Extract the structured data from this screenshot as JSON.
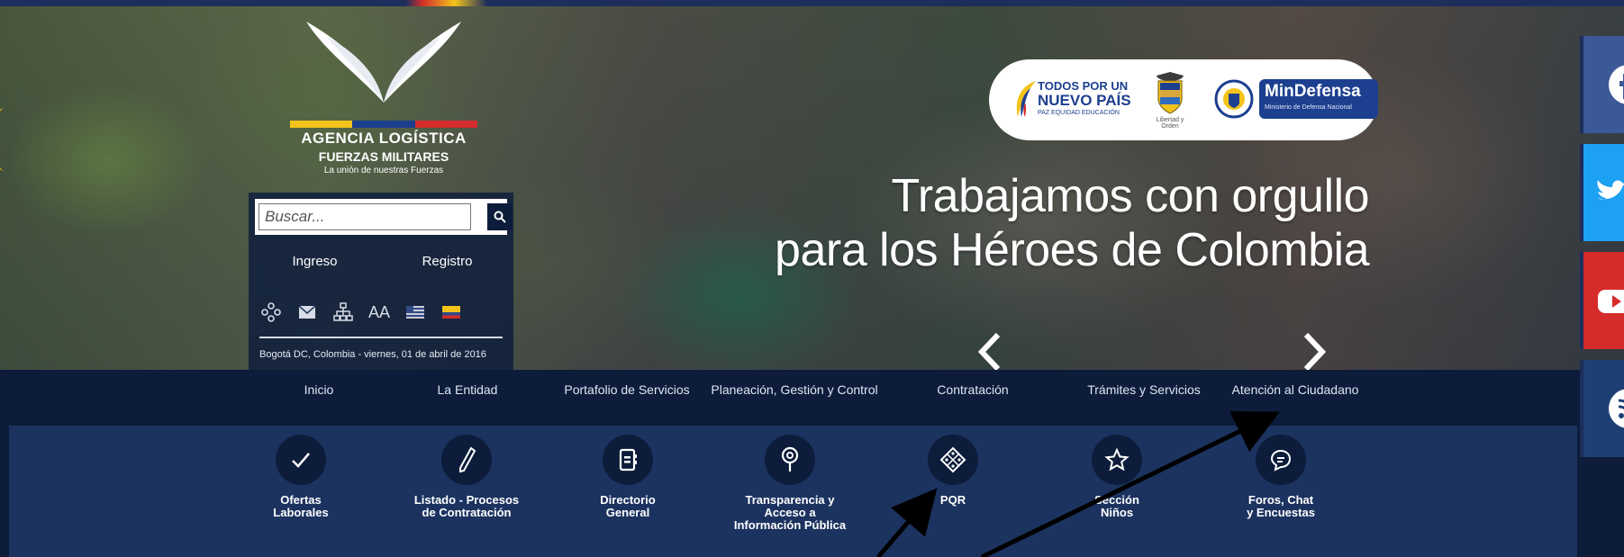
{
  "brand": {
    "name_line1": "AGENCIA LOGÍSTICA",
    "name_line2": "FUERZAS MILITARES",
    "tagline": "La unión de nuestras Fuerzas",
    "flag_colors": [
      "#f3c31b",
      "#1c3f8f",
      "#d42c2c"
    ]
  },
  "search": {
    "placeholder": "Buscar...",
    "icon": "search-icon"
  },
  "auth": {
    "login": "Ingreso",
    "register": "Registro"
  },
  "tools": [
    {
      "icon": "sitemap-tree-icon"
    },
    {
      "icon": "mail-icon"
    },
    {
      "icon": "org-chart-icon"
    },
    {
      "icon": "text-size-icon",
      "text": "AA"
    },
    {
      "icon": "flag-us-icon"
    },
    {
      "icon": "flag-colombia-icon"
    }
  ],
  "date_text": "Bogotá DC, Colombia - viernes, 01 de abril de 2016",
  "badges": {
    "todos_line1": "TODOS POR UN",
    "todos_line2": "NUEVO PAÍS",
    "todos_line3": "PAZ  EQUIDAD  EDUCACIÓN",
    "shield_caption": "Libertad y Orden",
    "mindefensa_title": "MinDefensa",
    "mindefensa_subtitle": "Ministerio de Defensa Nacional"
  },
  "slogan": {
    "line1": "Trabajamos con orgullo",
    "line2": "para los Héroes de Colombia"
  },
  "nav": [
    "Inicio",
    "La Entidad",
    "Portafolio de Servicios",
    "Planeación, Gestión y Control",
    "Contratación",
    "Trámites y Servicios",
    "Atención al Ciudadano"
  ],
  "services": [
    {
      "label": "Ofertas\nLaborales",
      "icon": "check-icon"
    },
    {
      "label": "Listado - Procesos\nde Contratación",
      "icon": "pen-icon"
    },
    {
      "label": "Directorio\nGeneral",
      "icon": "address-book-icon"
    },
    {
      "label": "Transparencia y\nAcceso a\nInformación Pública",
      "icon": "location-pin-icon"
    },
    {
      "label": "PQR",
      "icon": "pqr-diamond-icon"
    },
    {
      "label": "Sección\nNiños",
      "icon": "star-icon"
    },
    {
      "label": "Foros, Chat\ny Encuestas",
      "icon": "chat-bubble-icon"
    }
  ],
  "social": [
    "facebook-icon",
    "twitter-icon",
    "youtube-icon",
    "rss-icon"
  ],
  "colors": {
    "navy": "#0c1c3a",
    "services_bg": "#1c3360",
    "facebook": "#3b5998",
    "twitter": "#1da1f2",
    "youtube": "#d62b2b"
  }
}
